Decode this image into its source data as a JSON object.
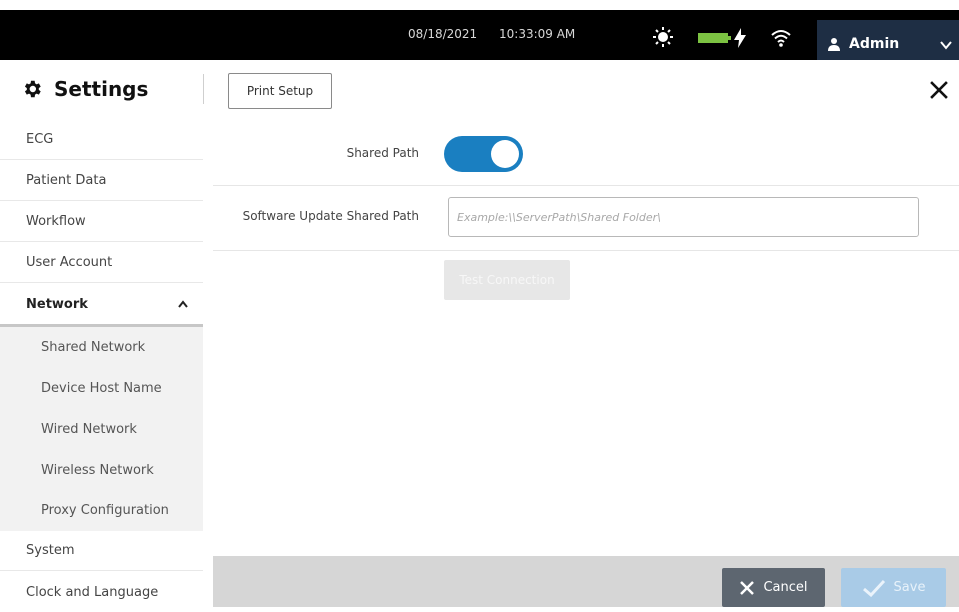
{
  "status_bar": {
    "date": "08/18/2021",
    "time": "10:33:09 AM",
    "icons": [
      "sun-icon",
      "battery-icon",
      "charging-bolt-icon",
      "wifi-icon"
    ],
    "user": {
      "label": "Admin",
      "icon": "user-icon",
      "dropdown_icon": "chevron-down-icon"
    }
  },
  "header": {
    "title": "Settings",
    "title_icon": "gear-icon",
    "tab_button": "Print Setup",
    "close_icon": "close-icon"
  },
  "sidebar": {
    "items": [
      {
        "label": "ECG"
      },
      {
        "label": "Patient Data"
      },
      {
        "label": "Workflow"
      },
      {
        "label": "User Account"
      },
      {
        "label": "Network",
        "expanded": true,
        "selected": true
      },
      {
        "label": "Shared Network",
        "sub": true
      },
      {
        "label": "Device Host Name",
        "sub": true
      },
      {
        "label": "Wired Network",
        "sub": true
      },
      {
        "label": "Wireless Network",
        "sub": true
      },
      {
        "label": "Proxy Configuration",
        "sub": true
      },
      {
        "label": "System"
      },
      {
        "label": "Clock and Language"
      }
    ]
  },
  "main": {
    "shared_path": {
      "label": "Shared Path",
      "enabled": true
    },
    "software_update_path": {
      "label": "Software Update Shared Path",
      "value": "",
      "placeholder": "Example:\\\\ServerPath\\Shared Folder\\"
    },
    "test_connection_label": "Test Connection"
  },
  "footer": {
    "cancel_label": "Cancel",
    "save_label": "Save"
  },
  "colors": {
    "top_bar": "#000000",
    "user_button": "#1e2e44",
    "toggle_on": "#1a7fc1",
    "battery": "#7cc242",
    "cancel_button": "#5d6670",
    "save_button_disabled": "#a9cbe7"
  }
}
